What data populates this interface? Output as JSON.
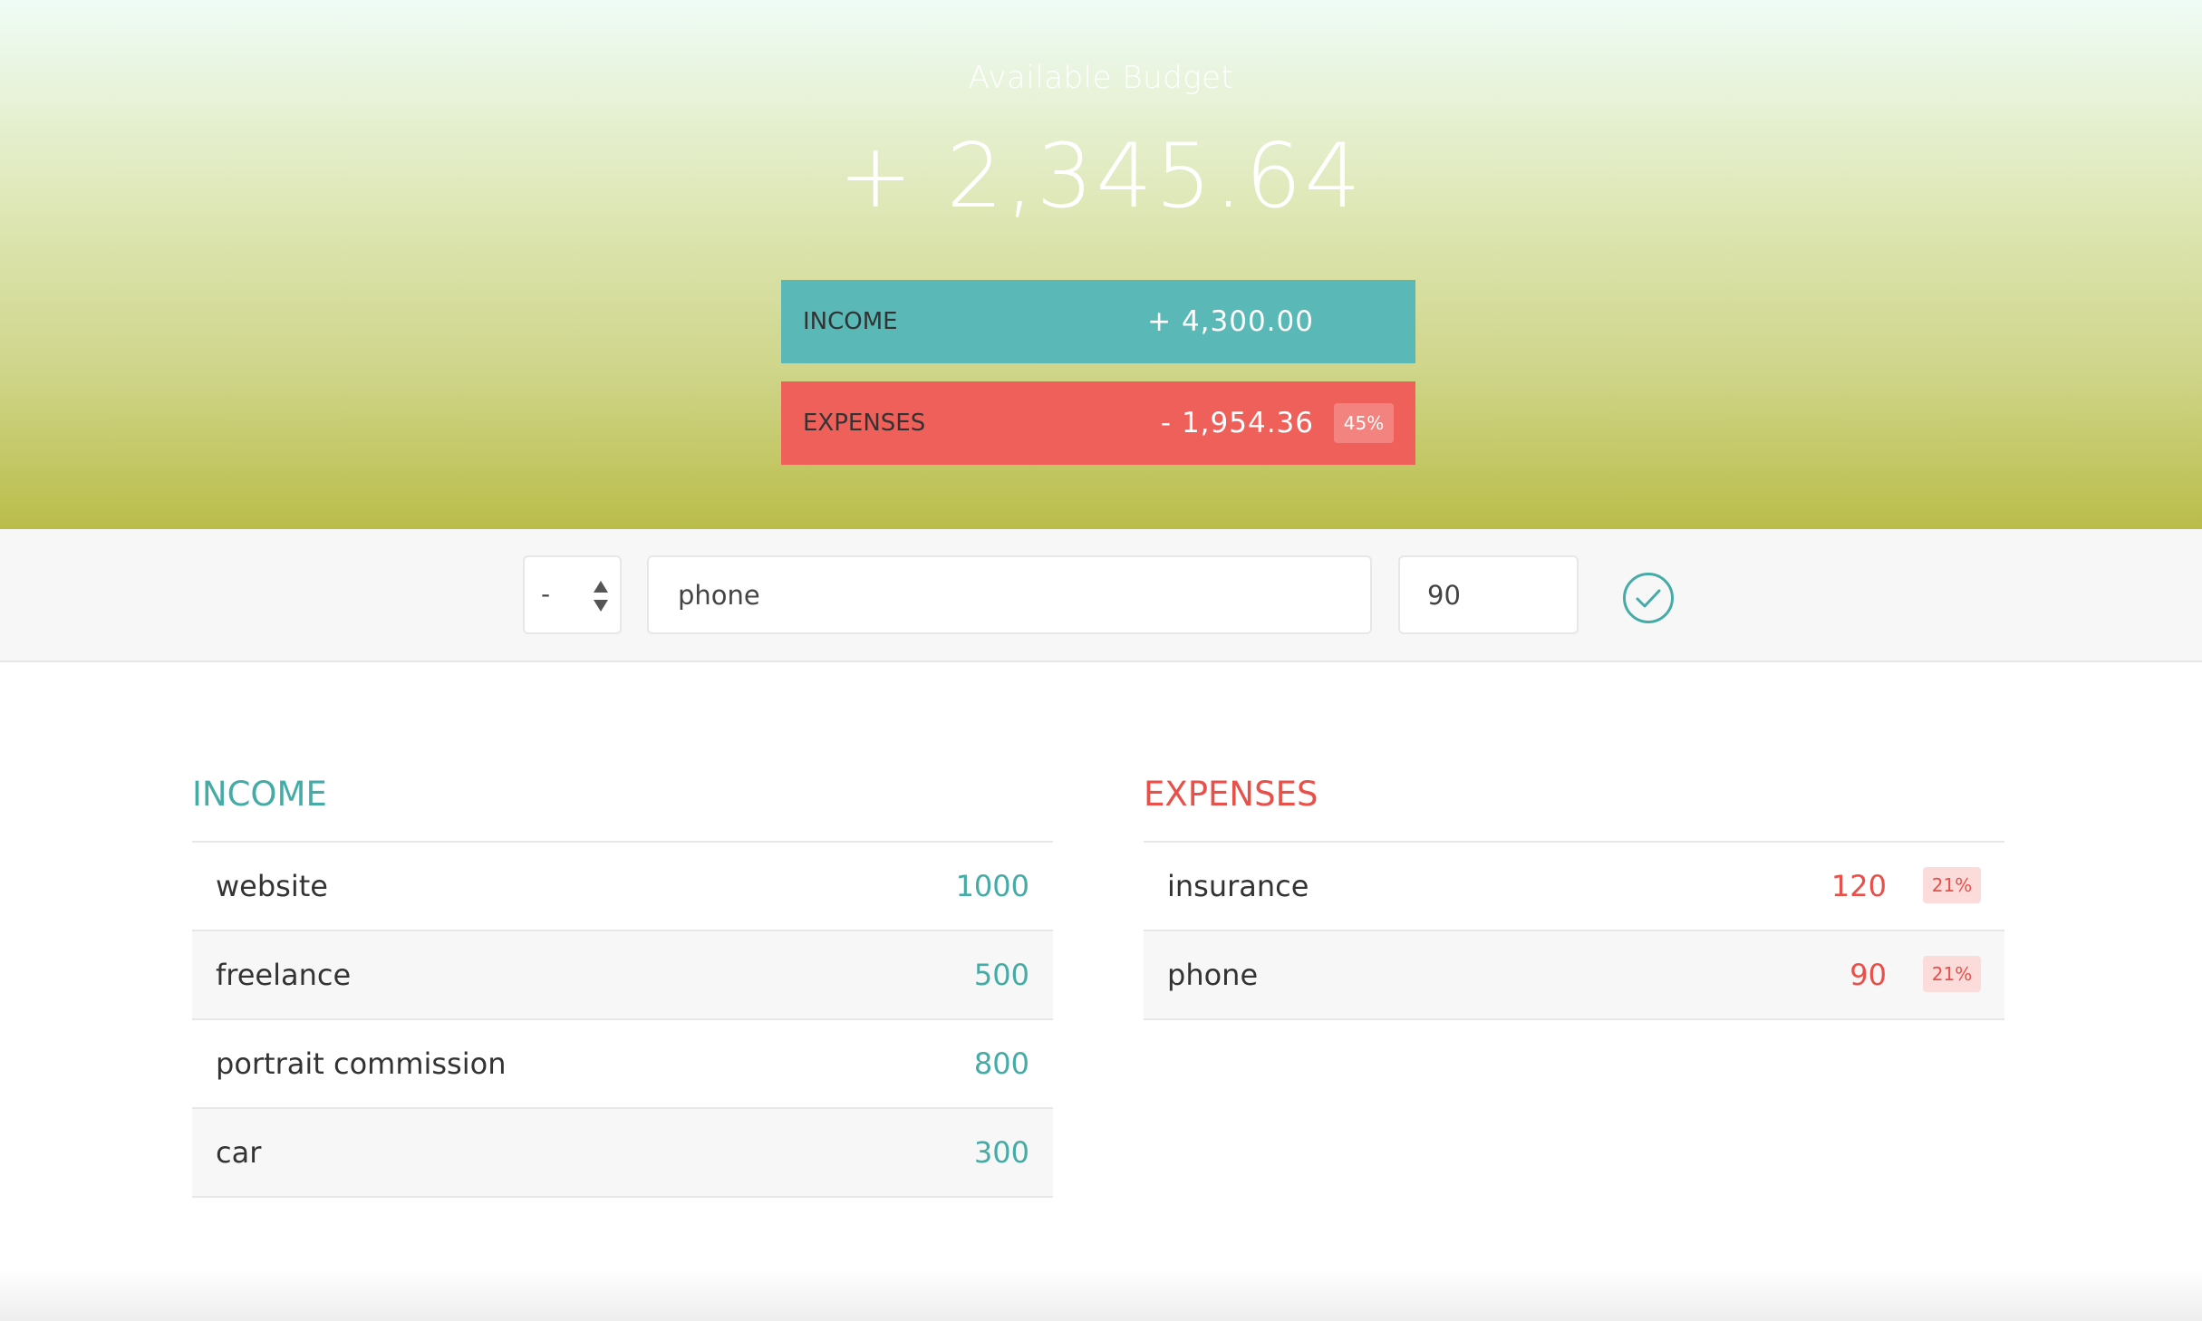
{
  "header": {
    "title": "Available Budget",
    "budget": "+ 2,345.64",
    "income": {
      "label": "Income",
      "value": "+ 4,300.00"
    },
    "expenses": {
      "label": "Expenses",
      "value": "- 1,954.36",
      "percentage": "45%"
    }
  },
  "add_form": {
    "type_value": "-",
    "description_value": "phone",
    "value_value": "90",
    "submit_icon": "check-circle-icon"
  },
  "income_list": {
    "title": "Income",
    "items": [
      {
        "description": "website",
        "value": "1000"
      },
      {
        "description": "freelance",
        "value": "500"
      },
      {
        "description": "portrait commission",
        "value": "800"
      },
      {
        "description": "car",
        "value": "300"
      }
    ]
  },
  "expenses_list": {
    "title": "Expenses",
    "items": [
      {
        "description": "insurance",
        "value": "120",
        "percentage": "21%"
      },
      {
        "description": "phone",
        "value": "90",
        "percentage": "21%"
      }
    ]
  },
  "colors": {
    "income": "#45aba6",
    "expenses": "#e9504a",
    "income_bar": "#5ab8b6",
    "expenses_bar": "#f0605a"
  }
}
